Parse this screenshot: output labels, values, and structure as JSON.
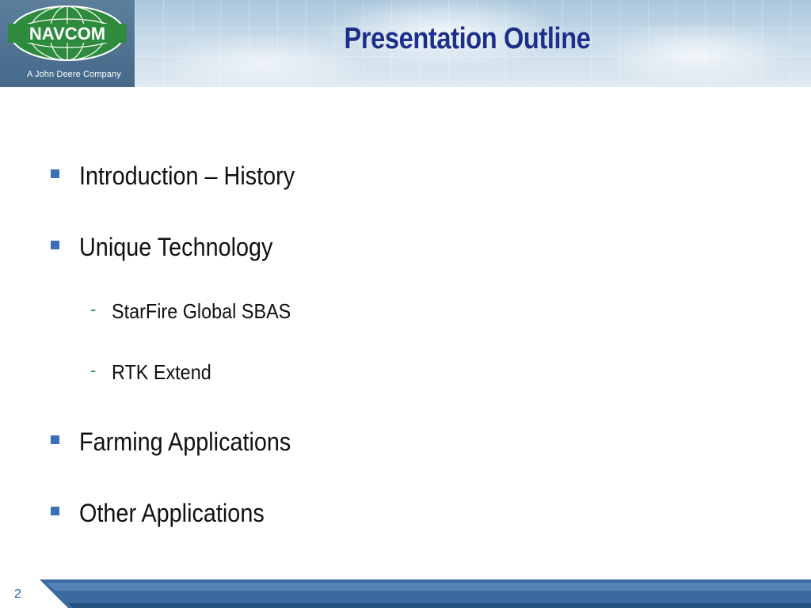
{
  "header": {
    "title": "Presentation Outline",
    "logo_text": "NAVCOM",
    "tagline": "A John Deere Company"
  },
  "bullets": [
    {
      "text": "Introduction – History"
    },
    {
      "text": "Unique Technology"
    },
    {
      "text": "Farming Applications"
    },
    {
      "text": "Other Applications"
    }
  ],
  "sub_bullets": [
    {
      "text": "StarFire Global SBAS"
    },
    {
      "text": "RTK Extend"
    }
  ],
  "sub_marker": "-",
  "footer": {
    "page_number": "2"
  },
  "colors": {
    "title": "#1c2f8c",
    "bullet_square": "#3b6fb6",
    "sub_dash": "#2f8c3a",
    "footer_bar": "#3a6a9f",
    "logo_green": "#2e8b3d"
  }
}
